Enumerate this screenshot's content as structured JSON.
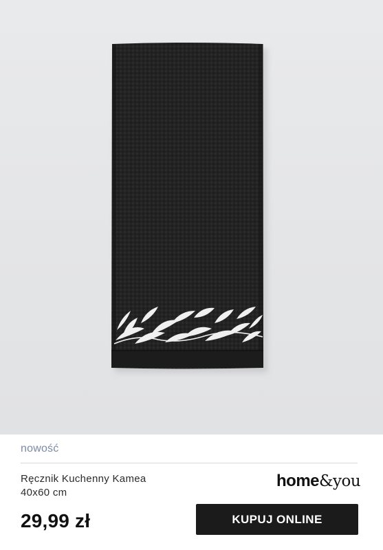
{
  "product": {
    "badge": "nowość",
    "name_line1": "Ręcznik Kuchenny Kamea",
    "name_line2": "40x60 cm",
    "price": "29,99 zł"
  },
  "brand": {
    "logo_part1": "home",
    "logo_part2": "&you"
  },
  "cta": {
    "label": "KUPUJ ONLINE"
  },
  "colors": {
    "badge": "#7b8aa6",
    "towel": "#232323",
    "embroidery": "#f0f0f0",
    "button": "#1b1b1b"
  },
  "image": {
    "subject": "black-kitchen-towel-with-white-leaf-embroidery"
  }
}
